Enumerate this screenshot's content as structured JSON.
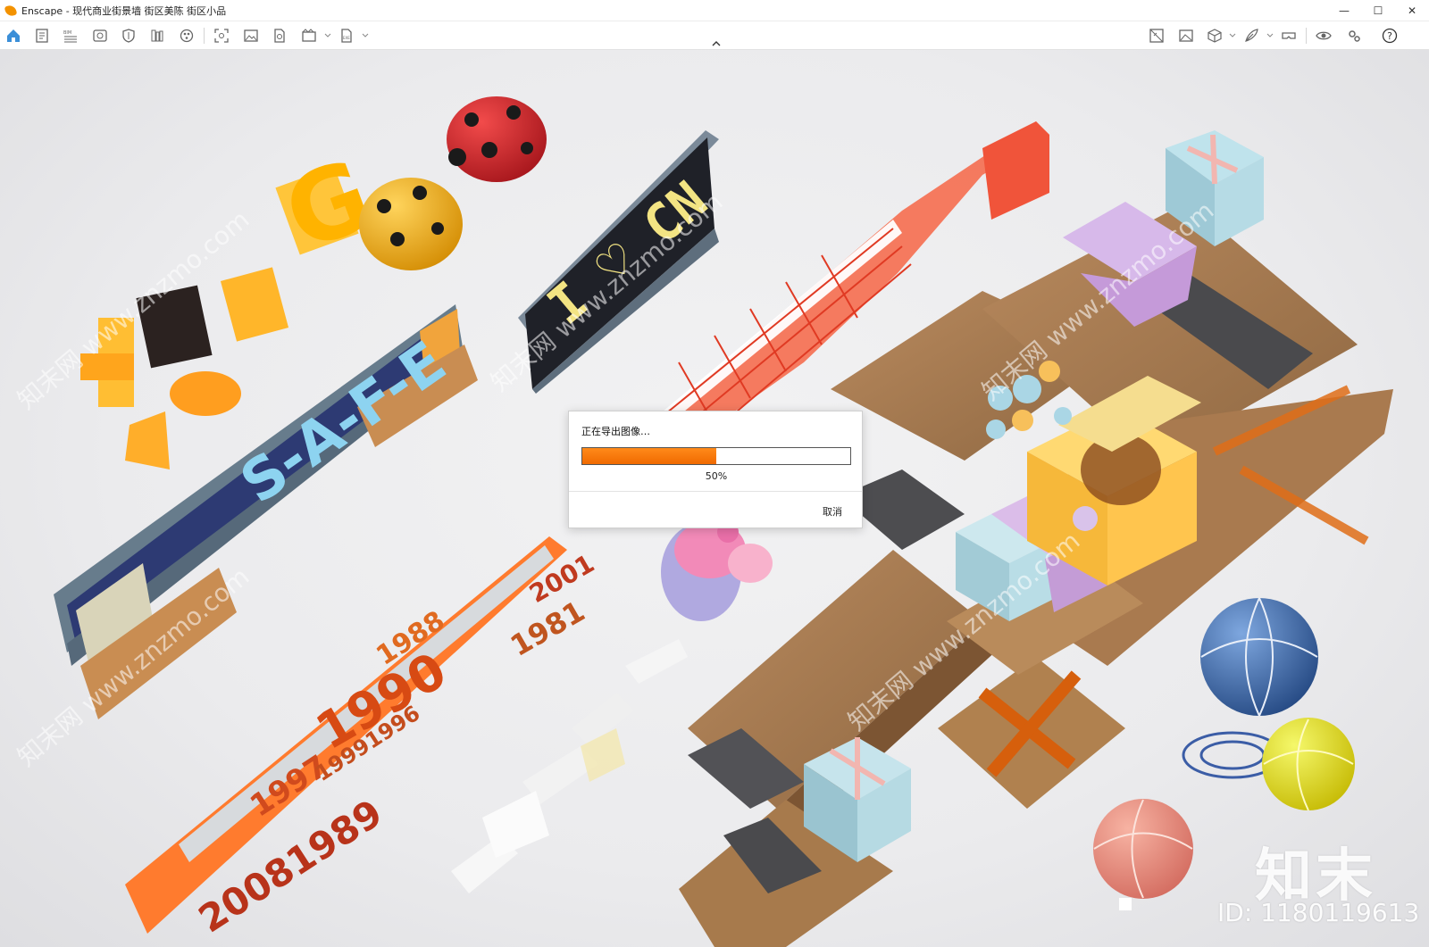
{
  "window": {
    "app_name": "Enscape",
    "title": "Enscape - 现代商业街景墙 街区美陈 街区小品",
    "controls": {
      "minimize": "—",
      "maximize": "☐",
      "close": "✕"
    }
  },
  "toolbar": {
    "left_icons": [
      "home-icon",
      "notes-icon",
      "bim-icon",
      "views-icon",
      "shield-icon",
      "library-icon",
      "materials-icon",
      "screenshot-icon",
      "image-export-icon",
      "batch-render-icon",
      "video-export-icon",
      "export-file-icon"
    ],
    "right_icons": [
      "site-context-icon",
      "render-settings-icon",
      "cube-view-icon",
      "feather-icon",
      "vr-headset-icon",
      "eye-icon",
      "settings-icon",
      "help-icon"
    ],
    "help_label": "?"
  },
  "dialog": {
    "title": "正在导出图像…",
    "progress": 0.5,
    "percent_label": "50%",
    "cancel_label": "取消",
    "progress_color": "#f97c0c"
  },
  "scene": {
    "sign_safe": "S-A-F-E",
    "sign_icn": "I ♡ CN",
    "years_1": "1990",
    "years_2": "2001",
    "years_3": "1981",
    "years_4": "20081989",
    "years_5": "1997",
    "years_6": "1988",
    "years_7": "19991996",
    "letters_sing": "G"
  },
  "watermark": {
    "brand": "知末",
    "id_text": "ID: 1180119613",
    "diagonal": "知末网 www.znzmo.com"
  }
}
